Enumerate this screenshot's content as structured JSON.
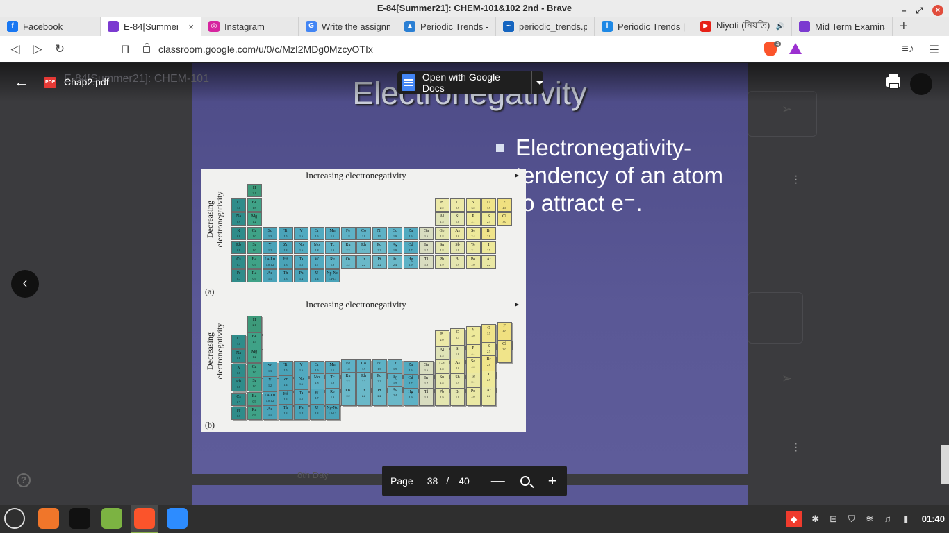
{
  "window": {
    "title": "E-84[Summer21]: CHEM-101&102 2nd - Brave",
    "min_glyph": "–",
    "restore_glyph": "⤢",
    "close_glyph": "×"
  },
  "tabs": [
    {
      "label": "Facebook",
      "icon": "facebook-icon",
      "color": "#1877f2",
      "glyph": "f"
    },
    {
      "label": "E-84[Summer2",
      "icon": "classroom-icon",
      "color": "#7b3ad0",
      "glyph": "",
      "active": true,
      "close": "×"
    },
    {
      "label": "Instagram",
      "icon": "instagram-icon",
      "color": "#d6249f",
      "glyph": "◎"
    },
    {
      "label": "Write the assignm",
      "icon": "google-icon",
      "color": "#4285f4",
      "glyph": "G"
    },
    {
      "label": "Periodic Trends - (",
      "icon": "flask-icon",
      "color": "#2a7fd4",
      "glyph": "▲"
    },
    {
      "label": "periodic_trends.p",
      "icon": "chart-icon",
      "color": "#1565c0",
      "glyph": "~"
    },
    {
      "label": "Periodic Trends | F",
      "icon": "libretexts-icon",
      "color": "#1e88e5",
      "glyph": "l"
    },
    {
      "label": "Niyoti (নিয়তি) -",
      "icon": "youtube-icon",
      "color": "#e62117",
      "glyph": "▶",
      "audio": "🔊"
    },
    {
      "label": "Mid Term Examina",
      "icon": "classroom-icon",
      "color": "#7b3ad0",
      "glyph": ""
    }
  ],
  "newtab_glyph": "+",
  "toolbar": {
    "back": "◁",
    "forward": "▷",
    "reload": "↻",
    "bookmark": "⊓",
    "url": "classroom.google.com/u/0/c/MzI2MDg0MzcyOTIx",
    "shield_count": "4",
    "playlist": "≡♪",
    "menu": "☰"
  },
  "viewer": {
    "file_name": "Chap2.pdf",
    "ghost_title": "E-84[Summer21]: CHEM-101",
    "open_with": "Open with Google Docs",
    "pdf_badge": "PDF",
    "back_arrow": "←",
    "prev": "‹",
    "help": "?",
    "ghost_text": "8th Day",
    "page_label": "Page",
    "page_current": "38",
    "page_sep": "/",
    "page_total": "40",
    "zoom_out": "—",
    "zoom_in": "+"
  },
  "slide": {
    "title": "Electronegativity",
    "bullet": "Electronegativity- tendency of an atom to attract e⁻.",
    "figure": {
      "top_caption": "Increasing electronegativity",
      "side_caption_1": "Decreasing",
      "side_caption_2": "electronegativity",
      "label_a": "(a)",
      "label_b": "(b)"
    },
    "elements": [
      {
        "s": "H",
        "v": "2.1",
        "c": 1,
        "r": 0,
        "g": "#3d9a7a"
      },
      {
        "s": "Li",
        "v": "1.0",
        "c": 0,
        "r": 1,
        "g": "#2f8c8a"
      },
      {
        "s": "Be",
        "v": "1.5",
        "c": 1,
        "r": 1,
        "g": "#3fa287"
      },
      {
        "s": "B",
        "v": "2.0",
        "c": 13,
        "r": 1,
        "g": "#ece9a8"
      },
      {
        "s": "C",
        "v": "2.5",
        "c": 14,
        "r": 1,
        "g": "#ece9a8"
      },
      {
        "s": "N",
        "v": "3.0",
        "c": 15,
        "r": 1,
        "g": "#eee99a"
      },
      {
        "s": "O",
        "v": "3.5",
        "c": 16,
        "r": 1,
        "g": "#f0e48a"
      },
      {
        "s": "F",
        "v": "4.0",
        "c": 17,
        "r": 1,
        "g": "#f0e080"
      },
      {
        "s": "Na",
        "v": "0.9",
        "c": 0,
        "r": 2,
        "g": "#2f8c8a"
      },
      {
        "s": "Mg",
        "v": "1.2",
        "c": 1,
        "r": 2,
        "g": "#3fa287"
      },
      {
        "s": "Al",
        "v": "1.5",
        "c": 13,
        "r": 2,
        "g": "#dfe3b8"
      },
      {
        "s": "Si",
        "v": "1.8",
        "c": 14,
        "r": 2,
        "g": "#e4e6b0"
      },
      {
        "s": "P",
        "v": "2.1",
        "c": 15,
        "r": 2,
        "g": "#eee99a"
      },
      {
        "s": "S",
        "v": "2.5",
        "c": 16,
        "r": 2,
        "g": "#eee99a"
      },
      {
        "s": "Cl",
        "v": "3.0",
        "c": 17,
        "r": 2,
        "g": "#f0e48a"
      },
      {
        "s": "K",
        "v": "0.8",
        "c": 0,
        "r": 3,
        "g": "#2f8c8a"
      },
      {
        "s": "Ca",
        "v": "1.0",
        "c": 1,
        "r": 3,
        "g": "#3fa287"
      },
      {
        "s": "Sc",
        "v": "1.3",
        "c": 2,
        "r": 3,
        "g": "#4aa3b8"
      },
      {
        "s": "Ti",
        "v": "1.5",
        "c": 3,
        "r": 3,
        "g": "#4aa3b8"
      },
      {
        "s": "V",
        "v": "1.6",
        "c": 4,
        "r": 3,
        "g": "#52aac0"
      },
      {
        "s": "Cr",
        "v": "1.6",
        "c": 5,
        "r": 3,
        "g": "#52aac0"
      },
      {
        "s": "Mn",
        "v": "1.5",
        "c": 6,
        "r": 3,
        "g": "#52aac0"
      },
      {
        "s": "Fe",
        "v": "1.8",
        "c": 7,
        "r": 3,
        "g": "#5eb2c6"
      },
      {
        "s": "Co",
        "v": "1.9",
        "c": 8,
        "r": 3,
        "g": "#5eb2c6"
      },
      {
        "s": "Ni",
        "v": "1.9",
        "c": 9,
        "r": 3,
        "g": "#5eb2c6"
      },
      {
        "s": "Cu",
        "v": "1.9",
        "c": 10,
        "r": 3,
        "g": "#5eb2c6"
      },
      {
        "s": "Zn",
        "v": "1.6",
        "c": 11,
        "r": 3,
        "g": "#52aac0"
      },
      {
        "s": "Ga",
        "v": "1.6",
        "c": 12,
        "r": 3,
        "g": "#d8dcc0"
      },
      {
        "s": "Ge",
        "v": "1.8",
        "c": 13,
        "r": 3,
        "g": "#e4e6b0"
      },
      {
        "s": "As",
        "v": "2.0",
        "c": 14,
        "r": 3,
        "g": "#eae8a4"
      },
      {
        "s": "Se",
        "v": "2.4",
        "c": 15,
        "r": 3,
        "g": "#eee99a"
      },
      {
        "s": "Br",
        "v": "2.8",
        "c": 16,
        "r": 3,
        "g": "#f0e48a"
      },
      {
        "s": "Rb",
        "v": "0.8",
        "c": 0,
        "r": 4,
        "g": "#2f8c8a"
      },
      {
        "s": "Sr",
        "v": "1.0",
        "c": 1,
        "r": 4,
        "g": "#3fa287"
      },
      {
        "s": "Y",
        "v": "1.2",
        "c": 2,
        "r": 4,
        "g": "#4aa3b8"
      },
      {
        "s": "Zr",
        "v": "1.4",
        "c": 3,
        "r": 4,
        "g": "#4aa3b8"
      },
      {
        "s": "Nb",
        "v": "1.6",
        "c": 4,
        "r": 4,
        "g": "#52aac0"
      },
      {
        "s": "Mo",
        "v": "1.8",
        "c": 5,
        "r": 4,
        "g": "#5eb2c6"
      },
      {
        "s": "Tc",
        "v": "1.9",
        "c": 6,
        "r": 4,
        "g": "#5eb2c6"
      },
      {
        "s": "Ru",
        "v": "2.2",
        "c": 7,
        "r": 4,
        "g": "#6ab8c8"
      },
      {
        "s": "Rh",
        "v": "2.2",
        "c": 8,
        "r": 4,
        "g": "#6ab8c8"
      },
      {
        "s": "Pd",
        "v": "2.2",
        "c": 9,
        "r": 4,
        "g": "#6ab8c8"
      },
      {
        "s": "Ag",
        "v": "1.9",
        "c": 10,
        "r": 4,
        "g": "#5eb2c6"
      },
      {
        "s": "Cd",
        "v": "1.7",
        "c": 11,
        "r": 4,
        "g": "#52aac0"
      },
      {
        "s": "In",
        "v": "1.7",
        "c": 12,
        "r": 4,
        "g": "#d8dcc0"
      },
      {
        "s": "Sn",
        "v": "1.8",
        "c": 13,
        "r": 4,
        "g": "#e4e6b0"
      },
      {
        "s": "Sb",
        "v": "1.9",
        "c": 14,
        "r": 4,
        "g": "#e4e6b0"
      },
      {
        "s": "Te",
        "v": "2.1",
        "c": 15,
        "r": 4,
        "g": "#eae8a4"
      },
      {
        "s": "I",
        "v": "2.5",
        "c": 16,
        "r": 4,
        "g": "#eee99a"
      },
      {
        "s": "Cs",
        "v": "0.7",
        "c": 0,
        "r": 5,
        "g": "#2f8c8a"
      },
      {
        "s": "Ba",
        "v": "0.9",
        "c": 1,
        "r": 5,
        "g": "#3fa287"
      },
      {
        "s": "La-Lu",
        "v": "1.0-1.2",
        "c": 2,
        "r": 5,
        "g": "#4aa3b8"
      },
      {
        "s": "Hf",
        "v": "1.3",
        "c": 3,
        "r": 5,
        "g": "#4aa3b8"
      },
      {
        "s": "Ta",
        "v": "1.5",
        "c": 4,
        "r": 5,
        "g": "#52aac0"
      },
      {
        "s": "W",
        "v": "1.7",
        "c": 5,
        "r": 5,
        "g": "#52aac0"
      },
      {
        "s": "Re",
        "v": "1.9",
        "c": 6,
        "r": 5,
        "g": "#5eb2c6"
      },
      {
        "s": "Os",
        "v": "2.2",
        "c": 7,
        "r": 5,
        "g": "#6ab8c8"
      },
      {
        "s": "Ir",
        "v": "2.2",
        "c": 8,
        "r": 5,
        "g": "#6ab8c8"
      },
      {
        "s": "Pt",
        "v": "2.2",
        "c": 9,
        "r": 5,
        "g": "#6ab8c8"
      },
      {
        "s": "Au",
        "v": "2.4",
        "c": 10,
        "r": 5,
        "g": "#6ab8c8"
      },
      {
        "s": "Hg",
        "v": "1.9",
        "c": 11,
        "r": 5,
        "g": "#5eb2c6"
      },
      {
        "s": "Tl",
        "v": "1.8",
        "c": 12,
        "r": 5,
        "g": "#d8dcc0"
      },
      {
        "s": "Pb",
        "v": "1.9",
        "c": 13,
        "r": 5,
        "g": "#e4e6b0"
      },
      {
        "s": "Bi",
        "v": "1.9",
        "c": 14,
        "r": 5,
        "g": "#e4e6b0"
      },
      {
        "s": "Po",
        "v": "2.0",
        "c": 15,
        "r": 5,
        "g": "#eae8a4"
      },
      {
        "s": "At",
        "v": "2.2",
        "c": 16,
        "r": 5,
        "g": "#eae8a4"
      },
      {
        "s": "Fr",
        "v": "0.7",
        "c": 0,
        "r": 6,
        "g": "#2f8c8a"
      },
      {
        "s": "Ra",
        "v": "0.9",
        "c": 1,
        "r": 6,
        "g": "#3fa287"
      },
      {
        "s": "Ac",
        "v": "1.1",
        "c": 2,
        "r": 6,
        "g": "#4aa3b8"
      },
      {
        "s": "Th",
        "v": "1.3",
        "c": 3,
        "r": 6,
        "g": "#4aa3b8"
      },
      {
        "s": "Pa",
        "v": "1.4",
        "c": 4,
        "r": 6,
        "g": "#4aa3b8"
      },
      {
        "s": "U",
        "v": "1.4",
        "c": 5,
        "r": 6,
        "g": "#4aa3b8"
      },
      {
        "s": "Np-No",
        "v": "1.4-1.3",
        "c": 6,
        "r": 6,
        "g": "#4aa3b8"
      }
    ]
  },
  "taskbar": {
    "clock": "01:40",
    "apps": [
      {
        "name": "mint-menu-icon",
        "color": "#2f2f2f"
      },
      {
        "name": "firefox-icon",
        "color": "#f0762a"
      },
      {
        "name": "terminal-icon",
        "color": "#111111"
      },
      {
        "name": "files-icon",
        "color": "#7cb342"
      },
      {
        "name": "brave-icon",
        "color": "#fb542b"
      },
      {
        "name": "zoom-icon",
        "color": "#2d8cff"
      }
    ],
    "tray": [
      "◆",
      "✱",
      "⊟",
      "⛉",
      "≋",
      "♫",
      "▮"
    ]
  }
}
